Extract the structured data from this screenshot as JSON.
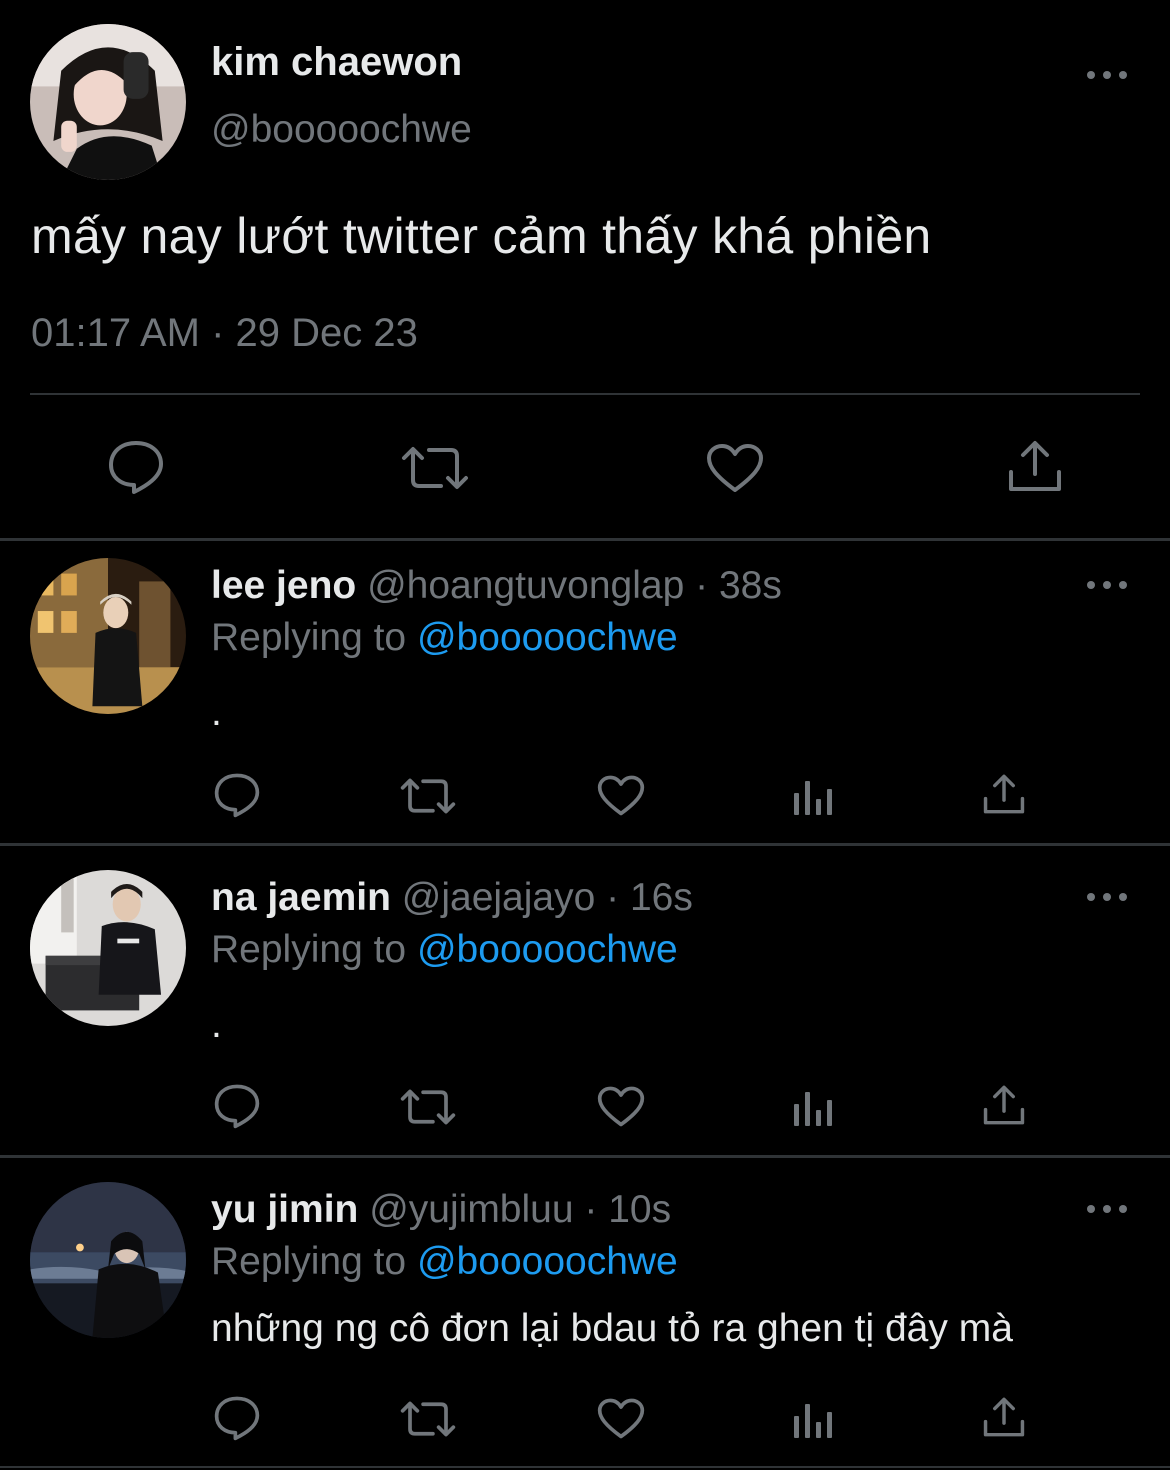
{
  "main_tweet": {
    "author": {
      "display_name": "kim chaewon",
      "handle": "@booooochwe"
    },
    "text": "mấy nay lướt twitter cảm thấy khá phiền",
    "timestamp": "01:17 AM · 29 Dec 23",
    "actions": [
      "reply-icon",
      "retweet-icon",
      "like-icon",
      "share-icon"
    ]
  },
  "replies": [
    {
      "display_name": "lee jeno",
      "handle": "@hoangtuvonglap",
      "separator": "·",
      "time": "38s",
      "replying_prefix": "Replying to",
      "replying_to": "@booooochwe",
      "text": "."
    },
    {
      "display_name": "na jaemin",
      "handle": "@jaejajayo",
      "separator": "·",
      "time": "16s",
      "replying_prefix": "Replying to",
      "replying_to": "@booooochwe",
      "text": "."
    },
    {
      "display_name": "yu jimin",
      "handle": "@yujimbluu",
      "separator": "·",
      "time": "10s",
      "replying_prefix": "Replying to",
      "replying_to": "@booooochwe",
      "text": "những ng cô đơn lại bdau tỏ ra ghen tị đây mà"
    }
  ],
  "reply_actions": [
    "reply-icon",
    "retweet-icon",
    "like-icon",
    "views-icon",
    "share-icon"
  ],
  "colors": {
    "background": "#000000",
    "primary_text": "#e7e9ea",
    "secondary_text": "#71767b",
    "mention": "#1d9bf0",
    "divider": "#2f3336"
  }
}
